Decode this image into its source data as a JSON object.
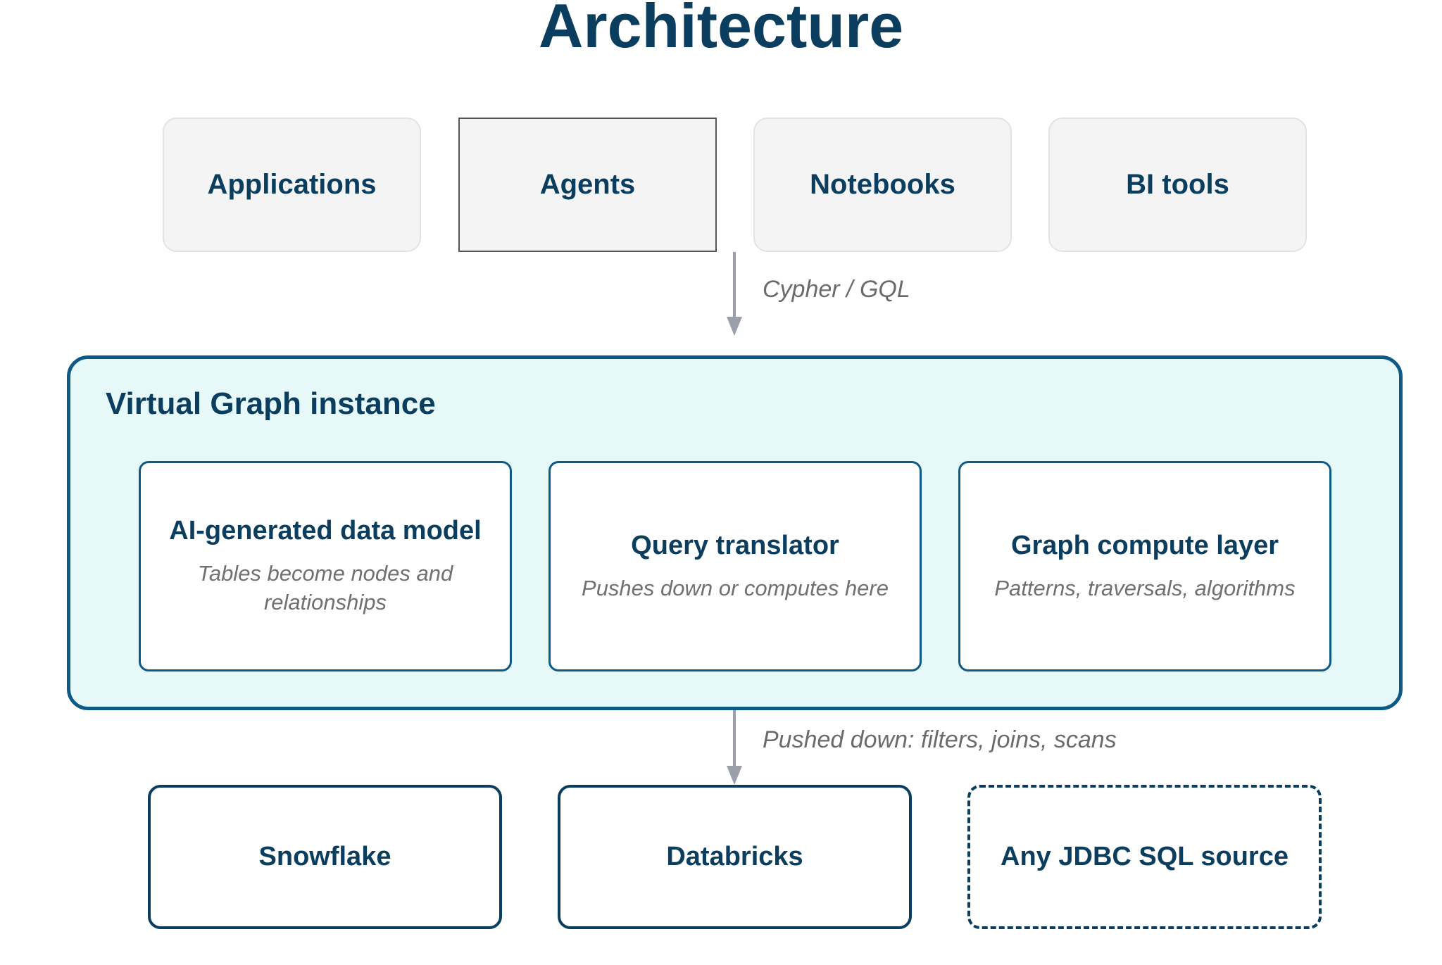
{
  "title": "Architecture",
  "clients": [
    {
      "label": "Applications"
    },
    {
      "label": "Agents"
    },
    {
      "label": "Notebooks"
    },
    {
      "label": "BI tools"
    }
  ],
  "edges": {
    "query_language": "Cypher / GQL",
    "pushdown": "Pushed down: filters, joins, scans"
  },
  "instance": {
    "title": "Virtual Graph instance",
    "components": [
      {
        "title": "AI-generated data model",
        "subtitle": "Tables become nodes and relationships"
      },
      {
        "title": "Query translator",
        "subtitle": "Pushes down or computes here"
      },
      {
        "title": "Graph compute layer",
        "subtitle": "Patterns, traversals, algorithms"
      }
    ]
  },
  "sources": [
    {
      "label": "Snowflake"
    },
    {
      "label": "Databricks"
    },
    {
      "label": "Any JDBC SQL source"
    }
  ],
  "colors": {
    "primary": "#0b3d5e",
    "border": "#0e5a86",
    "instance_bg": "#e7f8f9",
    "client_bg": "#f4f4f4",
    "arrow": "#9a9faa"
  }
}
